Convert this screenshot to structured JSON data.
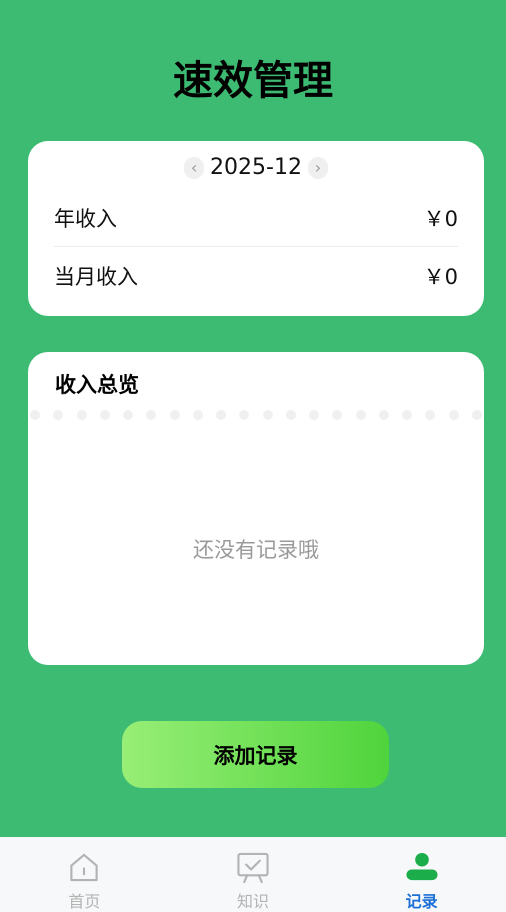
{
  "title": "速效管理",
  "summary": {
    "prev_icon": "chevron-left-icon",
    "month": "2025-12",
    "next_icon": "chevron-right-icon",
    "year_income_label": "年收入",
    "year_income_value": "￥0",
    "month_income_label": "当月收入",
    "month_income_value": "￥0"
  },
  "overview": {
    "title": "收入总览",
    "empty_text": "还没有记录哦"
  },
  "add_button": {
    "label": "添加记录"
  },
  "tabbar": {
    "items": [
      {
        "label": "首页",
        "icon": "home-icon",
        "active": false
      },
      {
        "label": "知识",
        "icon": "knowledge-board-icon",
        "active": false
      },
      {
        "label": "记录",
        "icon": "user-record-icon",
        "active": true
      }
    ]
  },
  "colors": {
    "background": "#3dbb72",
    "card": "#ffffff",
    "button_gradient_start": "#98ee76",
    "button_gradient_end": "#4fd43c",
    "tab_active": "#1b6fd6",
    "tab_inactive": "#b3b3b3",
    "active_icon": "#1aad4a"
  }
}
